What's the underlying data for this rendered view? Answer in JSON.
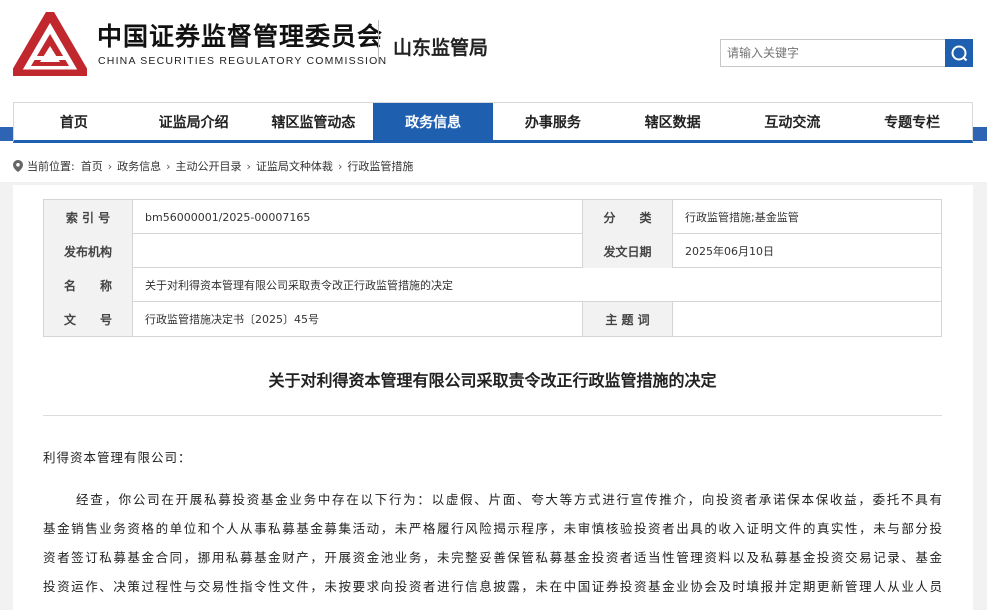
{
  "header": {
    "cn_name": "中国证券监督管理委员会",
    "en_name": "CHINA SECURITIES REGULATORY COMMISSION",
    "bureau": "山东监管局",
    "search_placeholder": "请输入关键字",
    "brand_color": "#c0282d",
    "accent_color": "#1e5fb0"
  },
  "nav": {
    "items": [
      {
        "label": "首页"
      },
      {
        "label": "证监局介绍"
      },
      {
        "label": "辖区监管动态"
      },
      {
        "label": "政务信息",
        "active": true
      },
      {
        "label": "办事服务"
      },
      {
        "label": "辖区数据"
      },
      {
        "label": "互动交流"
      },
      {
        "label": "专题专栏"
      }
    ]
  },
  "breadcrumb": {
    "prefix": "当前位置:",
    "items": [
      "首页",
      "政务信息",
      "主动公开目录",
      "证监局文种体裁",
      "行政监管措施"
    ]
  },
  "info": {
    "index_label": "索 引 号",
    "index_value": "bm56000001/2025-00007165",
    "category_label": "分　　类",
    "category_value": "行政监管措施;基金监管",
    "issuer_label": "发布机构",
    "issuer_value": "",
    "date_label": "发文日期",
    "date_value": "2025年06月10日",
    "name_label": "名　　称",
    "name_value": "关于对利得资本管理有限公司采取责令改正行政监管措施的决定",
    "docno_label": "文　　号",
    "docno_value": "行政监管措施决定书〔2025〕45号",
    "subject_label": "主 题 词",
    "subject_value": ""
  },
  "document": {
    "title": "关于对利得资本管理有限公司采取责令改正行政监管措施的决定",
    "addressee": "利得资本管理有限公司：",
    "lines": [
      "经查，你公司在开展私募投资基金业务中存在以下行为：以虚假、片面、夸大等方式进行宣传推介，向投资者承诺保本保收益，委托不具有",
      "基金销售业务资格的单位和个人从事私募基金募集活动，未严格履行风险揭示程序，未审慎核验投资者出具的收入证明文件的真实性，未与部分投",
      "资者签订私募基金合同，挪用私募基金财产，开展资金池业务，未完整妥善保管私募基金投资者适当性管理资料以及私募基金投资交易记录、基金",
      "投资运作、决策过程性与交易性指令性文件，未按要求向投资者进行信息披露，未在中国证券投资基金业协会及时填报并定期更新管理人从业人员"
    ]
  }
}
